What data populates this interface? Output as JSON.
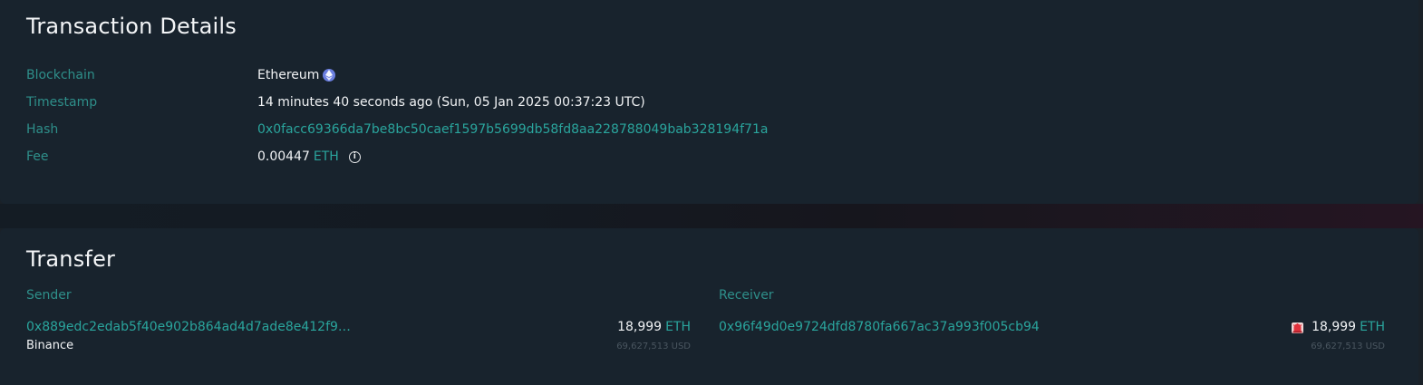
{
  "details": {
    "title": "Transaction Details",
    "rows": {
      "blockchain": {
        "label": "Blockchain",
        "value": "Ethereum"
      },
      "timestamp": {
        "label": "Timestamp",
        "value": "14 minutes 40 seconds ago (Sun, 05 Jan 2025 00:37:23 UTC)"
      },
      "hash": {
        "label": "Hash",
        "value": "0x0facc69366da7be8bc50caef1597b5699db58fd8aa228788049bab328194f71a"
      },
      "fee": {
        "label": "Fee",
        "value": "0.00447",
        "unit": "ETH"
      }
    }
  },
  "transfer": {
    "title": "Transfer",
    "sender": {
      "label": "Sender",
      "address": "0x889edc2edab5f40e902b864ad4d7ade8e412f9…",
      "entity": "Binance",
      "amount": "18,999",
      "unit": "ETH",
      "usd": "69,627,513 USD"
    },
    "receiver": {
      "label": "Receiver",
      "address": "0x96f49d0e9724dfd8780fa667ac37a993f005cb94",
      "amount": "18,999",
      "unit": "ETH",
      "usd": "69,627,513 USD"
    }
  },
  "icons": {
    "blockchain": "ethereum-icon",
    "fee_info": "info-icon",
    "receiver_alert": "alarm-icon"
  },
  "colors": {
    "background": "#1a2128",
    "card": "#18232d",
    "accent": "#2aa59d",
    "label": "#2e8f8a",
    "text": "#f1f3f5"
  }
}
